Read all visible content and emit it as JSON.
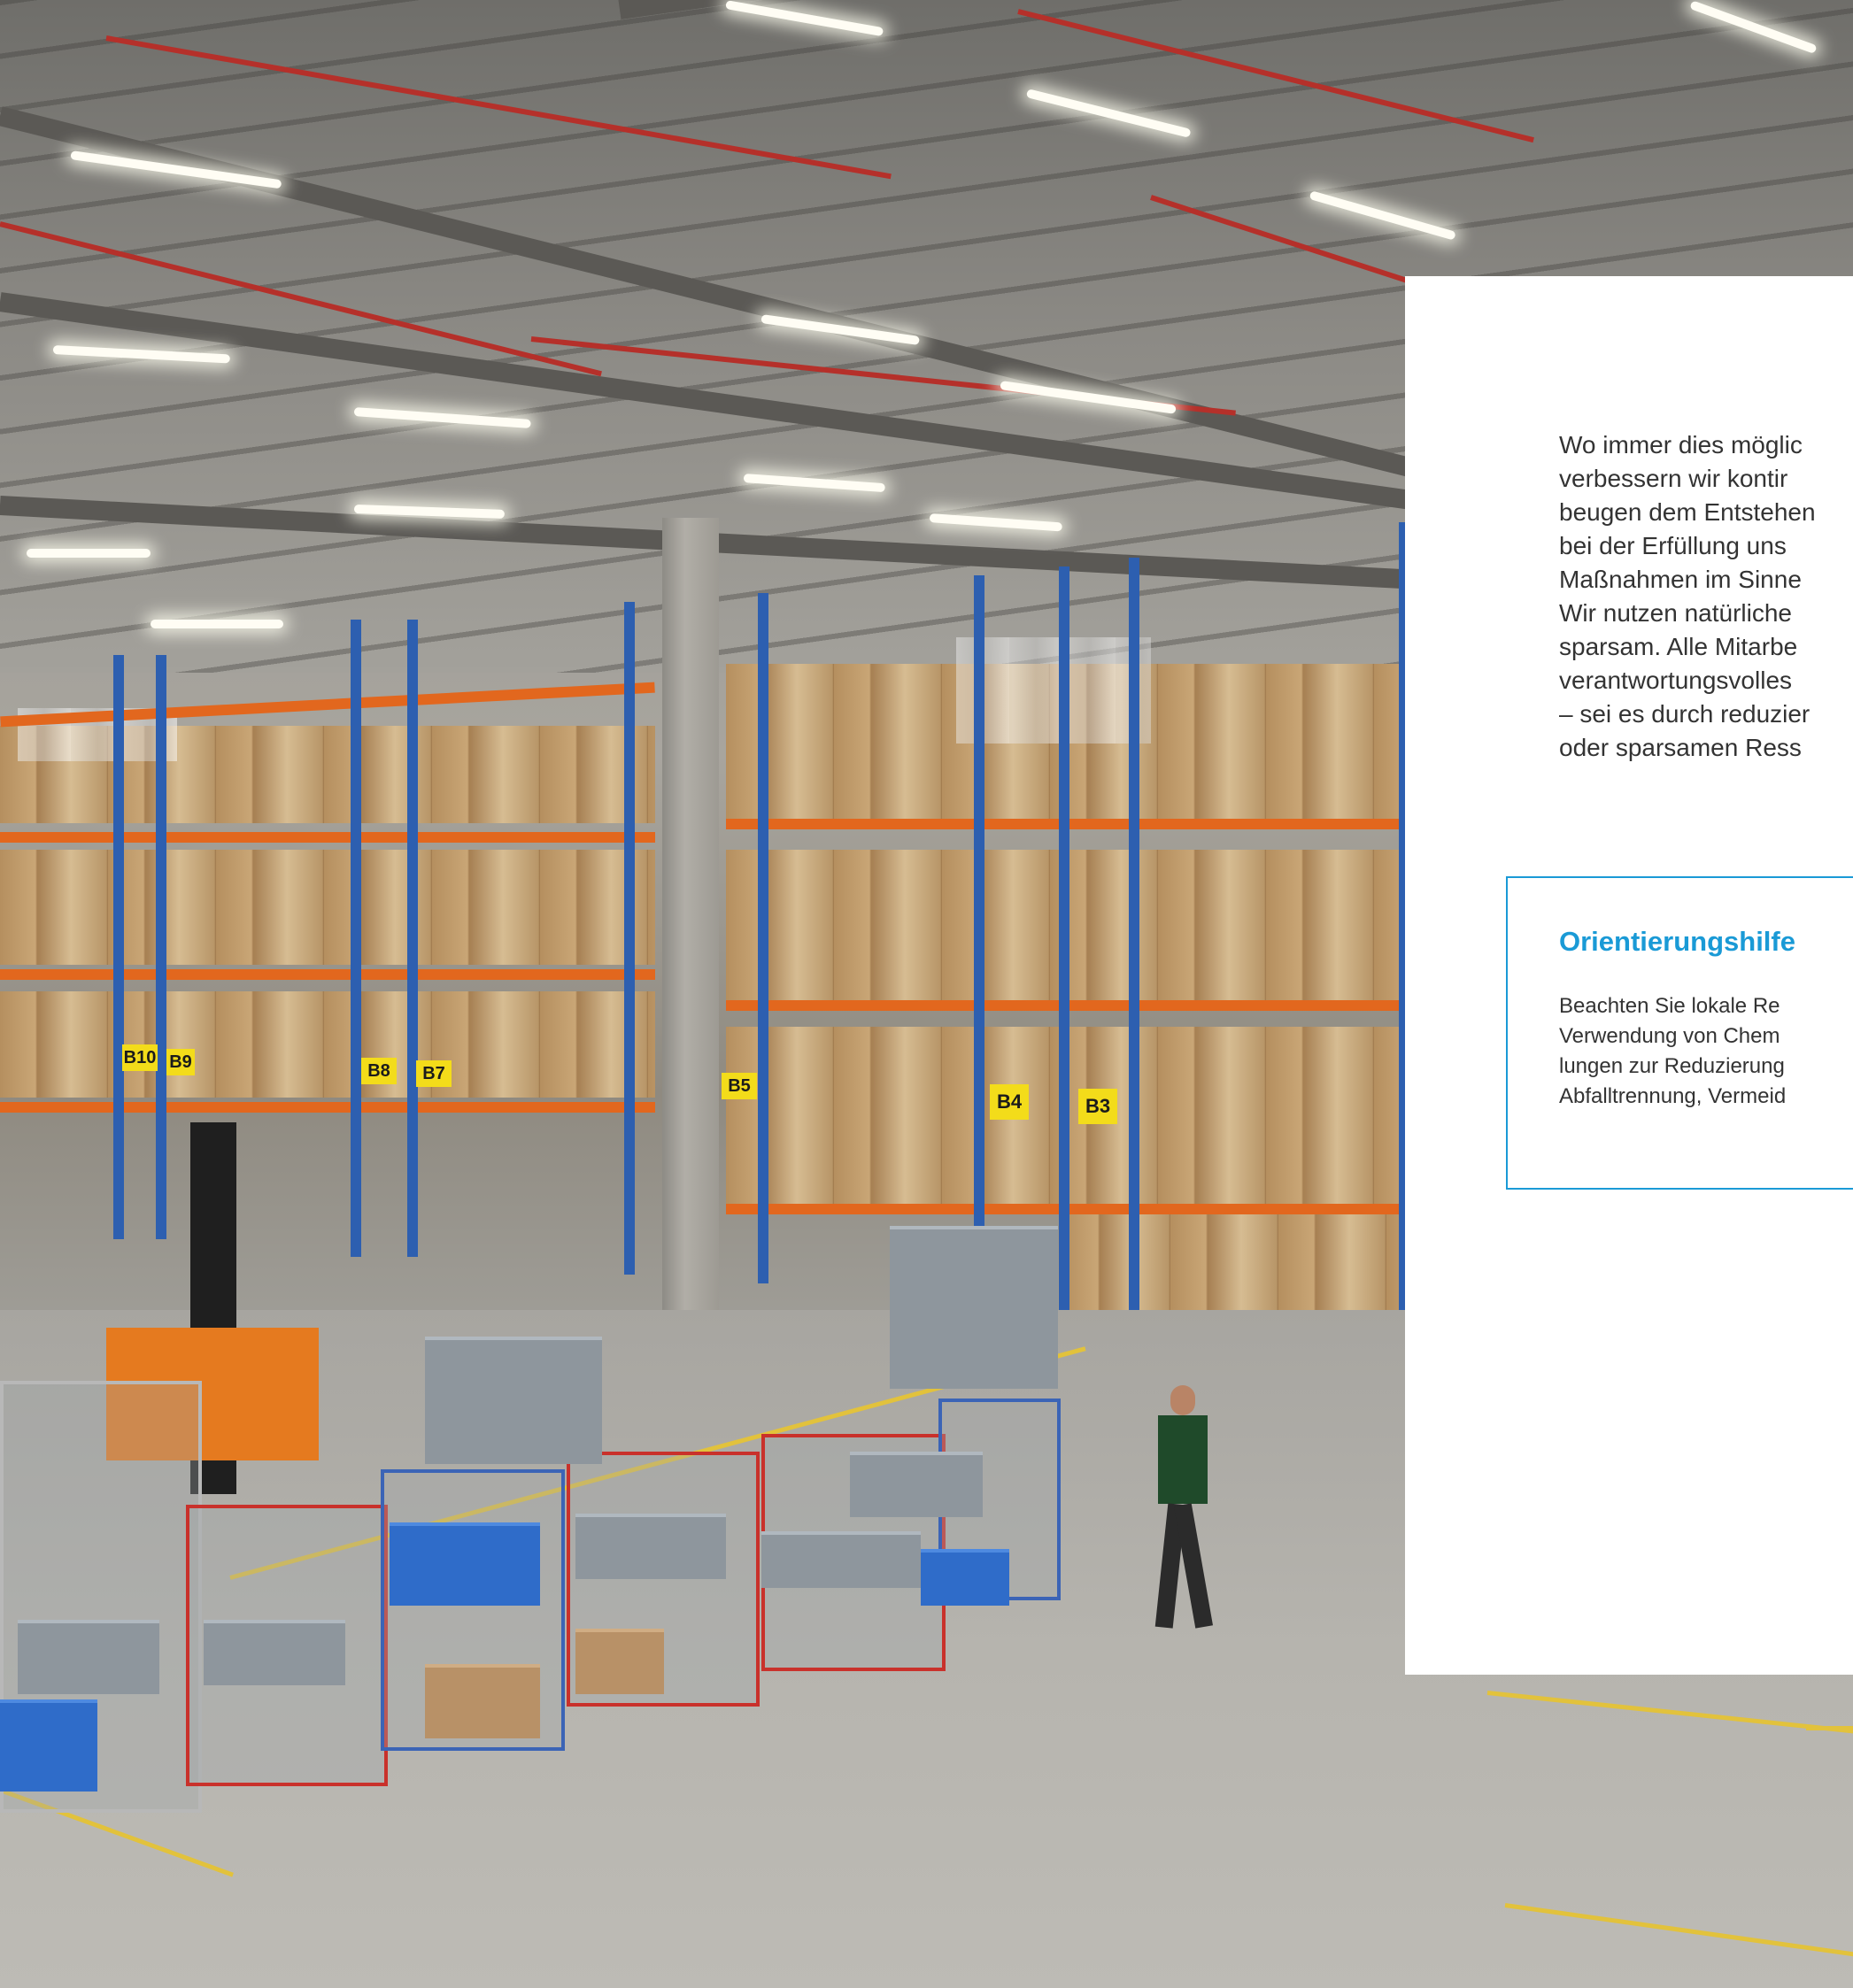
{
  "panel": {
    "body_lines": [
      "Wo immer dies möglic",
      "verbessern wir kontir",
      "beugen dem Entstehen",
      "bei der Erfüllung uns",
      "Maßnahmen im Sinne",
      "Wir nutzen natürliche",
      "sparsam. Alle Mitarbe",
      "verantwortungsvolles",
      "– sei es durch reduzier",
      "oder sparsamen Ress"
    ],
    "info_box": {
      "title": "Orientierungshilfe",
      "lines": [
        "Beachten Sie lokale Re",
        "Verwendung von Chem",
        "lungen zur Reduzierung",
        "Abfalltrennung, Vermeid"
      ],
      "border_color": "#1a9ad6"
    }
  },
  "photo": {
    "subject": "warehouse-interior",
    "rack_labels": [
      "B10",
      "B9",
      "B8",
      "B7",
      "B5",
      "B4",
      "B3"
    ]
  }
}
